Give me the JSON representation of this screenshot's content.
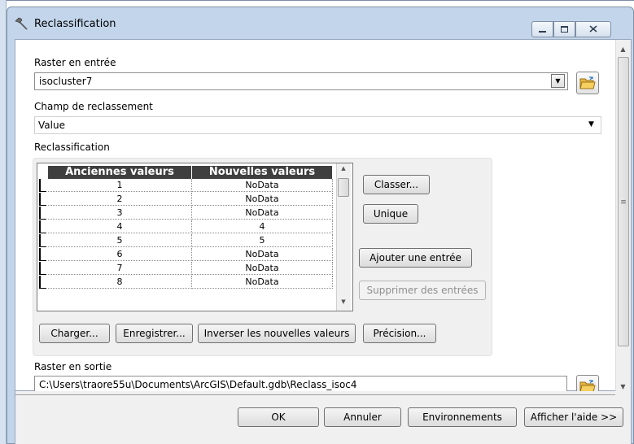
{
  "window": {
    "title": "Reclassification",
    "controls": {
      "minimize": "minimize-icon",
      "maximize": "maximize-icon",
      "close": "close-icon"
    }
  },
  "input_raster": {
    "label": "Raster en entrée",
    "value": "isocluster7"
  },
  "reclass_field": {
    "label": "Champ de reclassement",
    "value": "Value"
  },
  "reclassification": {
    "label": "Reclassification",
    "columns": [
      "Anciennes valeurs",
      "Nouvelles valeurs"
    ],
    "rows": [
      {
        "old": "1",
        "new": "NoData"
      },
      {
        "old": "2",
        "new": "NoData"
      },
      {
        "old": "3",
        "new": "NoData"
      },
      {
        "old": "4",
        "new": "4"
      },
      {
        "old": "5",
        "new": "5"
      },
      {
        "old": "6",
        "new": "NoData"
      },
      {
        "old": "7",
        "new": "NoData"
      },
      {
        "old": "8",
        "new": "NoData"
      }
    ],
    "side_buttons": {
      "classify": "Classer...",
      "unique": "Unique",
      "add_entry": "Ajouter une entrée",
      "delete_entries": "Supprimer des entrées"
    },
    "bottom_buttons": {
      "load": "Charger...",
      "save": "Enregistrer...",
      "reverse": "Inverser les nouvelles valeurs",
      "precision": "Précision..."
    }
  },
  "output_raster": {
    "label": "Raster en sortie",
    "value": "C:\\Users\\traore55u\\Documents\\ArcGIS\\Default.gdb\\Reclass_isoc4"
  },
  "footer": {
    "ok": "OK",
    "cancel": "Annuler",
    "environments": "Environnements",
    "show_help": "Afficher l'aide >>"
  },
  "colors": {
    "frame": "#c2d5ea",
    "table_header": "#3f3f3f",
    "folder_icon": "#f2c14e"
  }
}
